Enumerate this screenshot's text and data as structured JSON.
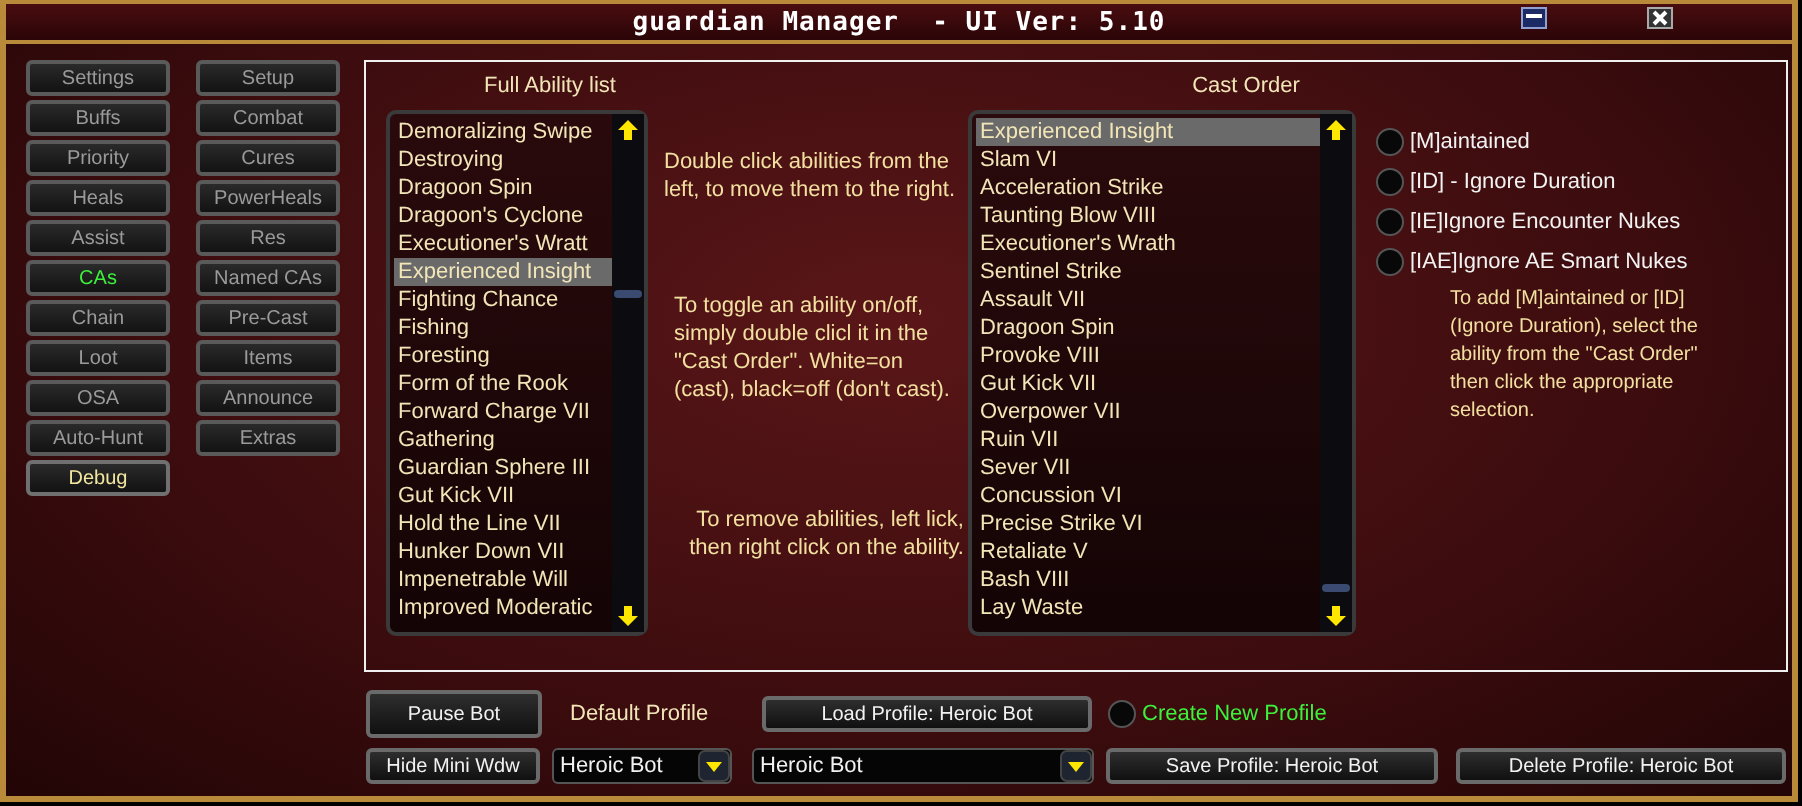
{
  "window": {
    "title": "guardian Manager  - UI Ver: 5.10"
  },
  "nav": [
    {
      "label": "Settings",
      "selected": false,
      "kind": "tab"
    },
    {
      "label": "Setup",
      "selected": false,
      "kind": "tab"
    },
    {
      "label": "Buffs",
      "selected": false,
      "kind": "tab"
    },
    {
      "label": "Combat",
      "selected": false,
      "kind": "tab"
    },
    {
      "label": "Priority",
      "selected": false,
      "kind": "tab"
    },
    {
      "label": "Cures",
      "selected": false,
      "kind": "tab"
    },
    {
      "label": "Heals",
      "selected": false,
      "kind": "tab"
    },
    {
      "label": "PowerHeals",
      "selected": false,
      "kind": "tab"
    },
    {
      "label": "Assist",
      "selected": false,
      "kind": "tab"
    },
    {
      "label": "Res",
      "selected": false,
      "kind": "tab"
    },
    {
      "label": "CAs",
      "selected": true,
      "kind": "tab"
    },
    {
      "label": "Named CAs",
      "selected": false,
      "kind": "tab"
    },
    {
      "label": "Chain",
      "selected": false,
      "kind": "tab"
    },
    {
      "label": "Pre-Cast",
      "selected": false,
      "kind": "tab"
    },
    {
      "label": "Loot",
      "selected": false,
      "kind": "tab"
    },
    {
      "label": "Items",
      "selected": false,
      "kind": "tab"
    },
    {
      "label": "OSA",
      "selected": false,
      "kind": "tab"
    },
    {
      "label": "Announce",
      "selected": false,
      "kind": "tab"
    },
    {
      "label": "Auto-Hunt",
      "selected": false,
      "kind": "tab"
    },
    {
      "label": "Extras",
      "selected": false,
      "kind": "tab"
    },
    {
      "label": "Debug",
      "selected": false,
      "kind": "toggle"
    }
  ],
  "full_list": {
    "title": "Full Ability list",
    "items": [
      {
        "label": "Demoralizing Swipe",
        "selected": false
      },
      {
        "label": "Destroying",
        "selected": false
      },
      {
        "label": "Dragoon Spin",
        "selected": false
      },
      {
        "label": "Dragoon's Cyclone",
        "selected": false
      },
      {
        "label": "Executioner's Wratt",
        "selected": false
      },
      {
        "label": "Experienced Insight",
        "selected": true
      },
      {
        "label": "Fighting Chance",
        "selected": false
      },
      {
        "label": "Fishing",
        "selected": false
      },
      {
        "label": "Foresting",
        "selected": false
      },
      {
        "label": "Form of the Rook",
        "selected": false
      },
      {
        "label": "Forward Charge VII",
        "selected": false
      },
      {
        "label": "Gathering",
        "selected": false
      },
      {
        "label": "Guardian Sphere III",
        "selected": false
      },
      {
        "label": "Gut Kick VII",
        "selected": false
      },
      {
        "label": "Hold the Line VII",
        "selected": false
      },
      {
        "label": "Hunker Down VII",
        "selected": false
      },
      {
        "label": "Impenetrable Will",
        "selected": false
      },
      {
        "label": "Improved Moderatic",
        "selected": false
      }
    ]
  },
  "instructions": [
    "Double click abilities from the left, to move them to the right.",
    "To toggle an ability on/off, simply double clicl it in the \"Cast Order\". White=on (cast), black=off (don't cast).",
    "To remove abilities, left lick, then right click on the ability."
  ],
  "cast_order": {
    "title": "Cast Order",
    "items": [
      {
        "label": "Experienced Insight",
        "selected": true
      },
      {
        "label": "Slam VI",
        "selected": false
      },
      {
        "label": "Acceleration Strike",
        "selected": false
      },
      {
        "label": "Taunting Blow VIII",
        "selected": false
      },
      {
        "label": "Executioner's Wrath",
        "selected": false
      },
      {
        "label": "Sentinel Strike",
        "selected": false
      },
      {
        "label": "Assault VII",
        "selected": false
      },
      {
        "label": "Dragoon Spin",
        "selected": false
      },
      {
        "label": "Provoke VIII",
        "selected": false
      },
      {
        "label": "Gut Kick VII",
        "selected": false
      },
      {
        "label": "Overpower VII",
        "selected": false
      },
      {
        "label": "Ruin VII",
        "selected": false
      },
      {
        "label": "Sever VII",
        "selected": false
      },
      {
        "label": "Concussion VI",
        "selected": false
      },
      {
        "label": "Precise Strike VI",
        "selected": false
      },
      {
        "label": "Retaliate V",
        "selected": false
      },
      {
        "label": "Bash VIII",
        "selected": false
      },
      {
        "label": "Lay Waste",
        "selected": false
      }
    ]
  },
  "options": [
    {
      "label": "[M]aintained",
      "checked": false
    },
    {
      "label": "[ID] - Ignore Duration",
      "checked": false
    },
    {
      "label": "[IE]Ignore Encounter Nukes",
      "checked": false
    },
    {
      "label": "[IAE]Ignore AE Smart Nukes",
      "checked": false
    }
  ],
  "options_help": "To add [M]aintained or [ID] (Ignore Duration), select the ability from the \"Cast Order\" then click the appropriate selection.",
  "bottom": {
    "pause_button": "Pause Bot",
    "default_profile_label": "Default Profile",
    "load_button": "Load Profile: Heroic Bot",
    "create_new": {
      "label": "Create New Profile",
      "checked": false
    },
    "hide_button": "Hide Mini Wdw",
    "default_profile_value": "Heroic Bot",
    "profile_value": "Heroic Bot",
    "save_button": "Save Profile: Heroic Bot",
    "delete_button": "Delete Profile: Heroic Bot"
  }
}
